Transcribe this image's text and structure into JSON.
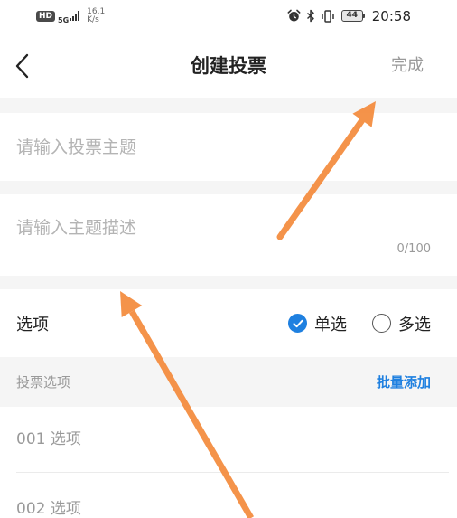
{
  "status_bar": {
    "hd_badge": "HD",
    "network_type": "5G",
    "data_speed": {
      "value": "16.1",
      "unit": "K/s"
    },
    "battery_level": "44",
    "time": "20:58",
    "icons": {
      "signal": "signal-bars-icon",
      "alarm": "alarm-icon",
      "bluetooth": "bluetooth-icon",
      "vibrate": "vibrate-icon",
      "battery": "battery-icon"
    }
  },
  "header": {
    "back_icon": "chevron-left-icon",
    "title": "创建投票",
    "done_label": "完成"
  },
  "topic_input": {
    "placeholder": "请输入投票主题"
  },
  "description_input": {
    "placeholder": "请输入主题描述",
    "counter": "0/100"
  },
  "option_type": {
    "label": "选项",
    "choices": [
      {
        "label": "单选",
        "selected": true,
        "icon": "check-circle-icon"
      },
      {
        "label": "多选",
        "selected": false,
        "icon": "empty-circle-icon"
      }
    ]
  },
  "options_section": {
    "title": "投票选项",
    "bulk_add_label": "批量添加",
    "items": [
      {
        "placeholder": "001 选项"
      },
      {
        "placeholder": "002 选项"
      }
    ]
  },
  "annotations": {
    "icon": "arrow-icon"
  },
  "colors": {
    "accent": "#1f80e0",
    "separator": "#f5f5f5",
    "divider": "#ebebeb",
    "text_primary": "#222222",
    "text_muted": "#9a9a9a",
    "placeholder": "#b4b4b4",
    "annotation": "#f48a3b"
  }
}
